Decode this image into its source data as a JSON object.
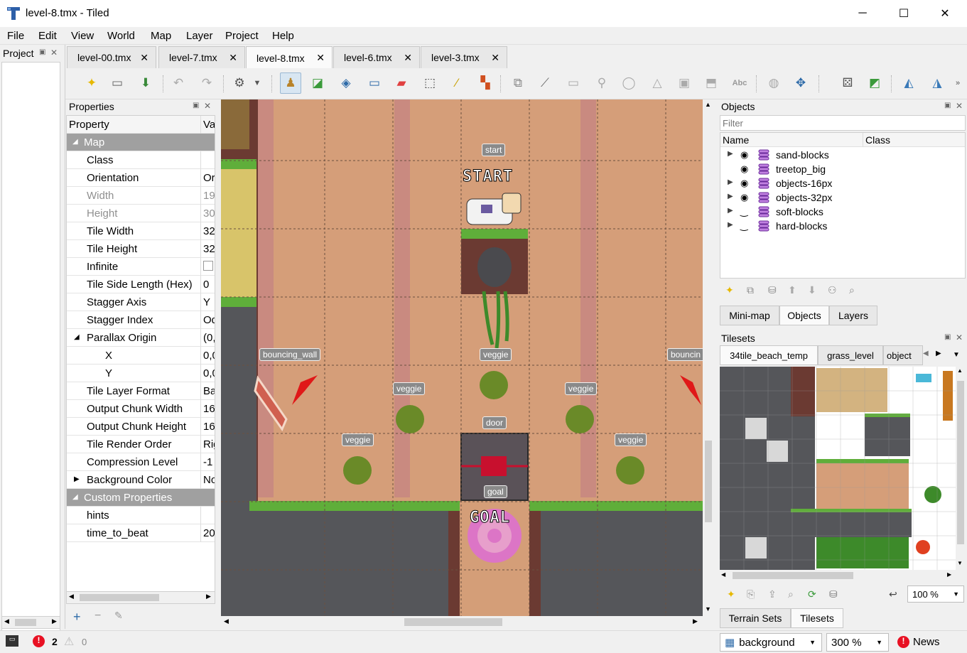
{
  "window": {
    "title": "level-8.tmx - Tiled",
    "minimize": "─",
    "maximize": "☐",
    "close": "✕"
  },
  "menu": [
    "File",
    "Edit",
    "View",
    "World",
    "Map",
    "Layer",
    "Project",
    "Help"
  ],
  "project_dock": {
    "title": "Project"
  },
  "tabs": [
    {
      "label": "level-00.tmx",
      "active": false
    },
    {
      "label": "level-7.tmx",
      "active": false
    },
    {
      "label": "level-8.tmx",
      "active": true
    },
    {
      "label": "level-6.tmx",
      "active": false
    },
    {
      "label": "level-3.tmx",
      "active": false
    }
  ],
  "properties": {
    "title": "Properties",
    "col_property": "Property",
    "col_value": "Val",
    "rows": [
      {
        "name": "Map",
        "value": "",
        "kind": "group",
        "caret": "◢"
      },
      {
        "name": "Class",
        "value": ""
      },
      {
        "name": "Orientation",
        "value": "Or"
      },
      {
        "name": "Width",
        "value": "19",
        "dim": true
      },
      {
        "name": "Height",
        "value": "30",
        "dim": true
      },
      {
        "name": "Tile Width",
        "value": "32"
      },
      {
        "name": "Tile Height",
        "value": "32"
      },
      {
        "name": "Infinite",
        "value": "",
        "checkbox": true
      },
      {
        "name": "Tile Side Length (Hex)",
        "value": "0"
      },
      {
        "name": "Stagger Axis",
        "value": "Y"
      },
      {
        "name": "Stagger Index",
        "value": "Od"
      },
      {
        "name": "Parallax Origin",
        "value": "(0,",
        "caret": "◢"
      },
      {
        "name": "X",
        "value": "0,0",
        "indent": true
      },
      {
        "name": "Y",
        "value": "0,0",
        "indent": true
      },
      {
        "name": "Tile Layer Format",
        "value": "Ba"
      },
      {
        "name": "Output Chunk Width",
        "value": "16"
      },
      {
        "name": "Output Chunk Height",
        "value": "16"
      },
      {
        "name": "Tile Render Order",
        "value": "Rig"
      },
      {
        "name": "Compression Level",
        "value": "-1"
      },
      {
        "name": "Background Color",
        "value": "No",
        "caret": "▶"
      },
      {
        "name": "Custom Properties",
        "value": "",
        "kind": "group",
        "caret": "◢"
      },
      {
        "name": "hints",
        "value": ""
      },
      {
        "name": "time_to_beat",
        "value": "20"
      }
    ]
  },
  "map_labels": {
    "start": "start",
    "start_banner": "START",
    "bouncing_wall": "bouncing_wall",
    "bouncing_right": "bouncin",
    "veggie": "veggie",
    "door": "door",
    "goal": "goal",
    "goal_banner": "GOAL"
  },
  "objects_dock": {
    "title": "Objects",
    "filter_placeholder": "Filter",
    "col_name": "Name",
    "col_class": "Class",
    "layers": [
      {
        "name": "sand-blocks",
        "expandable": true,
        "visible": true
      },
      {
        "name": "treetop_big",
        "expandable": false,
        "visible": true
      },
      {
        "name": "objects-16px",
        "expandable": true,
        "visible": true
      },
      {
        "name": "objects-32px",
        "expandable": true,
        "visible": true
      },
      {
        "name": "soft-blocks",
        "expandable": true,
        "visible": false
      },
      {
        "name": "hard-blocks",
        "expandable": true,
        "visible": false
      }
    ],
    "tabs": [
      "Mini-map",
      "Objects",
      "Layers"
    ],
    "active_tab": "Objects"
  },
  "tilesets_dock": {
    "title": "Tilesets",
    "tabs": [
      "34tile_beach_temp",
      "grass_level",
      "object"
    ],
    "zoom": "100 %",
    "bottom_tabs": [
      "Terrain Sets",
      "Tilesets"
    ],
    "active_bottom_tab": "Tilesets"
  },
  "statusbar": {
    "errors": "2",
    "warnings": "0",
    "layer": "background",
    "zoom": "300 %",
    "news": "News"
  },
  "colors": {
    "accent": "#0078d7",
    "error": "#e81123",
    "group_row": "#a0a0a0",
    "sand": "#d59e79"
  }
}
